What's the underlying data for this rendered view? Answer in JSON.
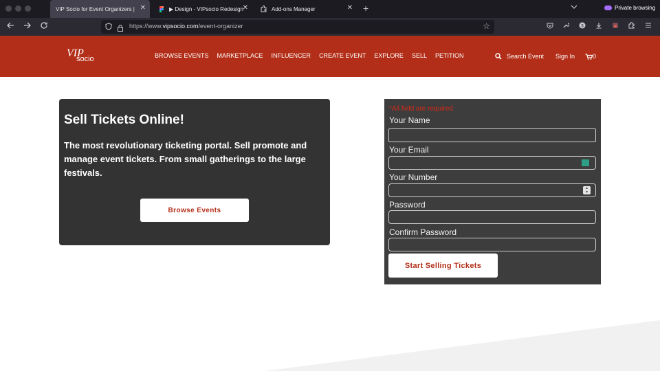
{
  "browser": {
    "tabs": [
      {
        "title": "VIP Socio for Event Organizers |",
        "favicon": "vipsocio-icon",
        "active": true
      },
      {
        "title": "▶ Design - VIPsocio Redesign |",
        "favicon": "figma-icon",
        "active": false
      },
      {
        "title": "Add-ons Manager",
        "favicon": "puzzle-icon",
        "active": false
      }
    ],
    "close_glyph": "✕",
    "new_tab_glyph": "+",
    "private_label": "Private browsing",
    "url_prefix": "https://www.",
    "url_domain": "vipsocio.com",
    "url_path": "/event-organizer"
  },
  "site": {
    "logo_vip": "VIP",
    "logo_socio": "socio",
    "nav": [
      "BROWSE EVENTS",
      "MARKETPLACE",
      "INFLUENCER",
      "CREATE EVENT",
      "EXPLORE",
      "SELL",
      "PETITION"
    ],
    "search_label": "Search Event",
    "signin_label": "Sign In",
    "cart_count": "0"
  },
  "hero": {
    "title": "Sell Tickets Online!",
    "description": "The most revolutionary ticketing portal. Sell promote and manage event tickets. From small gatherings to the large festivals.",
    "button_label": "Browse Events"
  },
  "form": {
    "required_note": "*All field are required",
    "fields": [
      {
        "label": "Your Name",
        "value": ""
      },
      {
        "label": "Your Email",
        "value": ""
      },
      {
        "label": "Your Number",
        "value": ""
      },
      {
        "label": "Password",
        "value": ""
      },
      {
        "label": "Confirm Password",
        "value": ""
      }
    ],
    "submit_label": "Start Selling Tickets"
  },
  "colors": {
    "brand_red": "#b22e18",
    "hero_bg": "#333333",
    "form_bg": "#3d3d3d",
    "required_red": "#d72a18"
  }
}
